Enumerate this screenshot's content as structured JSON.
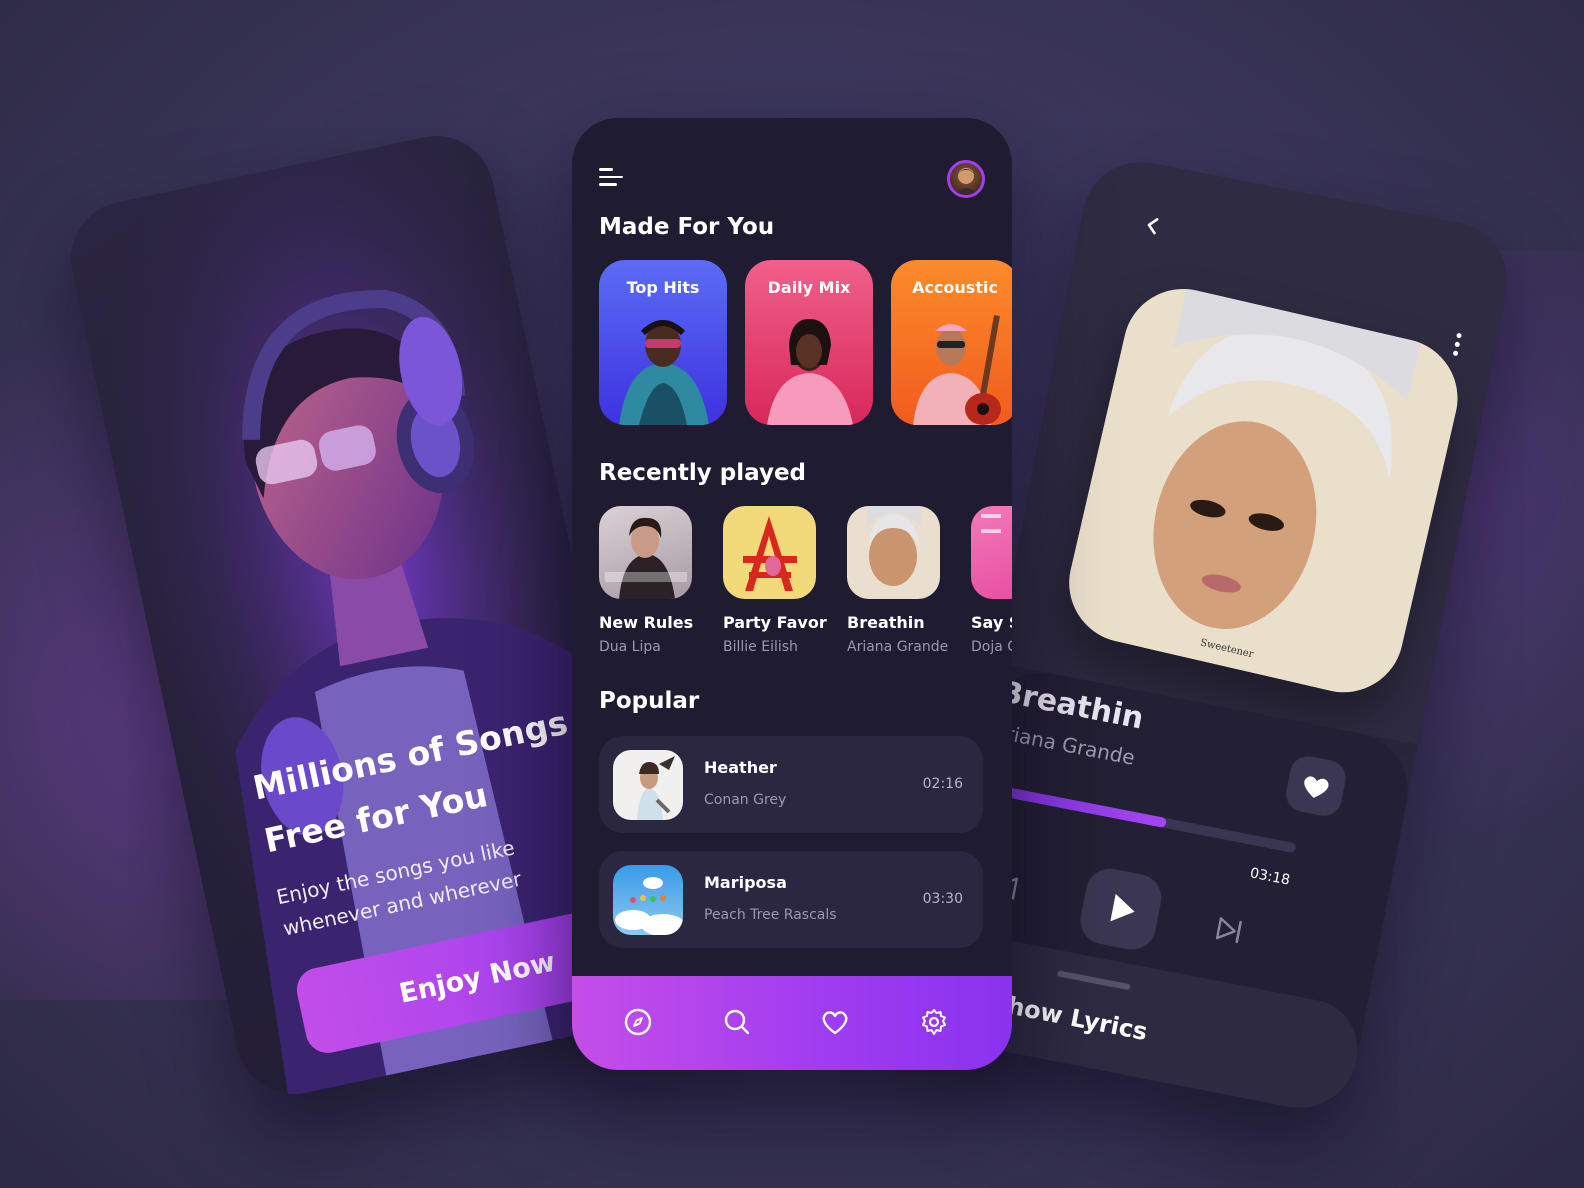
{
  "onboarding": {
    "title_line1": "Millions of Songs",
    "title_line2": "Free for You",
    "subtitle_line1": "Enjoy the songs you like",
    "subtitle_line2": "whenever and wherever",
    "cta_label": "Enjoy Now"
  },
  "home": {
    "made_for_you_title": "Made For You",
    "made_for_you": [
      {
        "label": "Top Hits",
        "color_top": "#5b6cf5",
        "color_bottom": "#3d32e0"
      },
      {
        "label": "Daily Mix",
        "color_top": "#f0608a",
        "color_bottom": "#d8285a"
      },
      {
        "label": "Accoustic",
        "color_top": "#fb8b2a",
        "color_bottom": "#f25b1e"
      }
    ],
    "recently_played_title": "Recently played",
    "recently_played": [
      {
        "title": "New Rules",
        "artist": "Dua Lipa"
      },
      {
        "title": "Party Favor",
        "artist": "Billie Eilish"
      },
      {
        "title": "Breathin",
        "artist": "Ariana Grande"
      },
      {
        "title": "Say S",
        "artist": "Doja C"
      }
    ],
    "popular_title": "Popular",
    "popular": [
      {
        "title": "Heather",
        "artist": "Conan Grey",
        "duration": "02:16"
      },
      {
        "title": "Mariposa",
        "artist": "Peach Tree Rascals",
        "duration": "03:30"
      }
    ],
    "nav": [
      "compass-icon",
      "search-icon",
      "heart-icon",
      "gear-icon"
    ],
    "accent": "#a43df0"
  },
  "player": {
    "song_title": "Breathin",
    "artist": "Ariana Grande",
    "time_current": "?",
    "time_total": "03:18",
    "progress": 0.6,
    "album_caption": "Sweetener",
    "lyrics_label": "Show Lyrics"
  }
}
